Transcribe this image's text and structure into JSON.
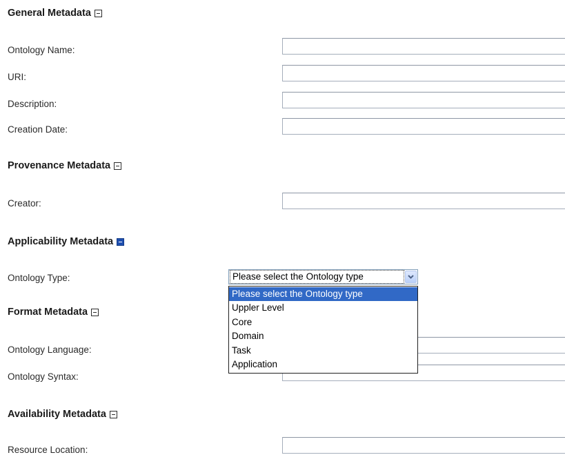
{
  "sections": {
    "general": {
      "title": "General Metadata",
      "fields": {
        "ontology_name": {
          "label": "Ontology Name:",
          "value": ""
        },
        "uri": {
          "label": "URI:",
          "value": ""
        },
        "description": {
          "label": "Description:",
          "value": ""
        },
        "creation_date": {
          "label": "Creation Date:",
          "value": ""
        }
      }
    },
    "provenance": {
      "title": "Provenance Metadata",
      "fields": {
        "creator": {
          "label": "Creator:",
          "value": ""
        }
      }
    },
    "applicability": {
      "title": "Applicability Metadata",
      "fields": {
        "ontology_type": {
          "label": "Ontology Type:",
          "selected": "Please select the Ontology type",
          "options": [
            "Please select the Ontology type",
            "Uppler Level",
            "Core",
            "Domain",
            "Task",
            "Application"
          ],
          "highlighted_index": 0
        }
      }
    },
    "format": {
      "title": "Format Metadata",
      "fields": {
        "ontology_language": {
          "label": "Ontology Language:",
          "value": ""
        },
        "ontology_syntax": {
          "label": "Ontology Syntax:",
          "value": ""
        }
      }
    },
    "availability": {
      "title": "Availability Metadata",
      "fields": {
        "resource_location": {
          "label": "Resource Location:",
          "value": ""
        }
      }
    }
  },
  "icons": {
    "collapse": "collapse-minus-icon",
    "dropdown_arrow": "chevron-down-icon"
  },
  "colors": {
    "highlight": "#3169c6",
    "filled_toggle": "#1f4fb0",
    "input_border": "#a4adba"
  }
}
